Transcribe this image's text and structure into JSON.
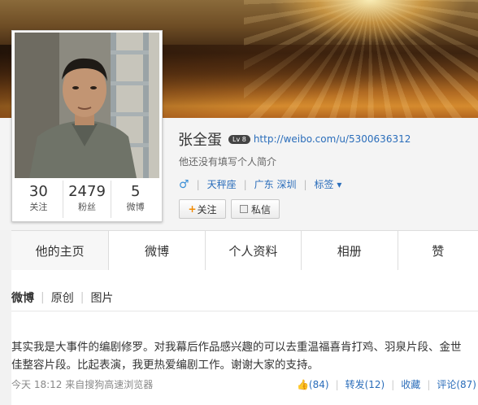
{
  "profile": {
    "name": "张全蛋",
    "level_badge": "Lv 8",
    "url": "http://weibo.com/u/5300636312",
    "intro": "他还没有填写个人简介",
    "gender_symbol": "♂",
    "constellation": "天秤座",
    "location": "广东 深圳",
    "tags_label": "标签",
    "tags_caret": "▾",
    "follow_plus": "+",
    "follow_label": "关注",
    "message_label": "私信"
  },
  "stats": [
    {
      "num": "30",
      "label": "关注"
    },
    {
      "num": "2479",
      "label": "粉丝"
    },
    {
      "num": "5",
      "label": "微博"
    }
  ],
  "tabs": [
    {
      "label": "他的主页"
    },
    {
      "label": "微博"
    },
    {
      "label": "个人资料"
    },
    {
      "label": "相册"
    },
    {
      "label": "赞"
    }
  ],
  "filters": [
    {
      "label": "微博"
    },
    {
      "label": "原创"
    },
    {
      "label": "图片"
    }
  ],
  "post": {
    "text": "其实我是大事件的编剧修罗。对我幕后作品感兴趣的可以去重温福喜肯打鸡、羽泉片段、金世佳整容片段。比起表演，我更热爱编剧工作。谢谢大家的支持。",
    "time": "今天 18:12",
    "source": "来自搜狗高速浏览器",
    "like_icon": "👍",
    "likes": "(84)",
    "repost": "转发(12)",
    "favorite": "收藏",
    "comment": "评论(87)"
  },
  "colors": {
    "link": "#2a6dba",
    "accent": "#f28a00"
  }
}
